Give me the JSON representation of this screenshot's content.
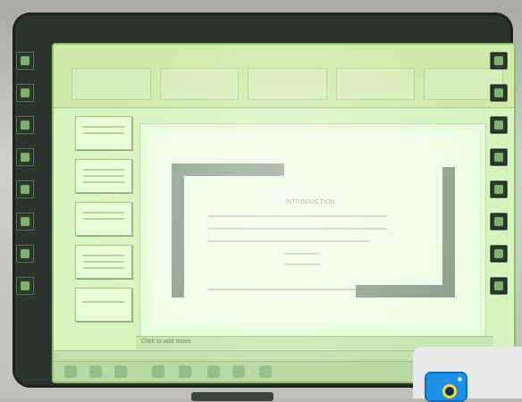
{
  "slide": {
    "title": "INTRODUCTION"
  },
  "notes": {
    "placeholder": "Click to add notes"
  },
  "colors": {
    "screen": "#d9f3bf",
    "slide_corner_bars": "#8ea38f",
    "board_frame": "#2b332d",
    "camera_icon": "#1d8fe6"
  },
  "icons": {
    "left_toolbar": [
      "pen-icon",
      "eraser-icon",
      "highlighter-icon",
      "select-icon",
      "shape-icon",
      "save-icon",
      "undo-icon",
      "redo-icon"
    ],
    "right_toolbar": [
      "pen-icon",
      "eraser-icon",
      "highlighter-icon",
      "select-icon",
      "shape-icon",
      "save-icon",
      "undo-icon",
      "redo-icon"
    ],
    "corner_badge": "camera-icon"
  }
}
